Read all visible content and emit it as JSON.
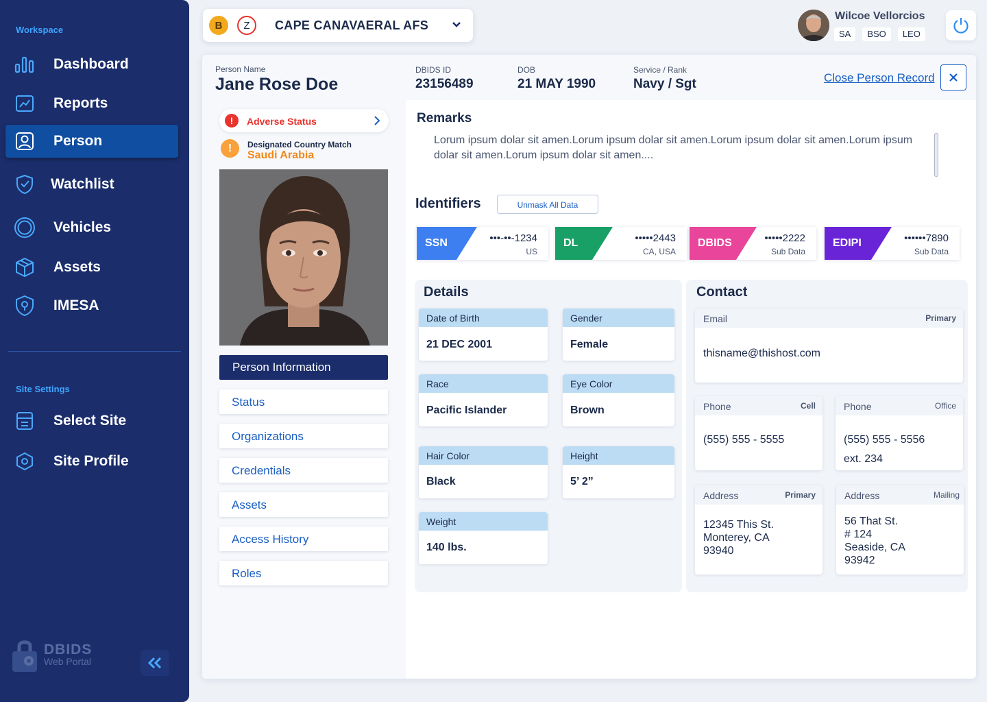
{
  "sidebar": {
    "workspace_label": "Workspace",
    "items": [
      {
        "label": "Dashboard"
      },
      {
        "label": "Reports"
      },
      {
        "label": "Person"
      },
      {
        "label": "Watchlist"
      },
      {
        "label": "Vehicles"
      },
      {
        "label": "Assets"
      },
      {
        "label": "IMESA"
      }
    ],
    "settings_label": "Site Settings",
    "settings_items": [
      {
        "label": "Select Site"
      },
      {
        "label": "Site Profile"
      }
    ],
    "logo_line1": "DBIDS",
    "logo_line2": "Web Portal",
    "active_item": "Person",
    "colors": {
      "background": "#1b2d6b",
      "active": "#0f4ea0",
      "section_label": "#3ea5ff"
    }
  },
  "topbar": {
    "badge_b": "B",
    "badge_z": "Z",
    "site_name": "CAPE CANAVAERAL AFS",
    "user_name": "Wilcoe Vellorcios",
    "roles": [
      "SA",
      "BSO",
      "LEO"
    ],
    "power_icon": "power-icon"
  },
  "person_header": {
    "name_label": "Person Name",
    "name": "Jane Rose Doe",
    "dbids_label": "DBIDS ID",
    "dbids_id": "23156489",
    "dob_label": "DOB",
    "dob": "21 MAY 1990",
    "service_label": "Service / Rank",
    "service": "Navy / Sgt",
    "close_link": "Close Person Record"
  },
  "status_panel": {
    "adverse_label": "Adverse Status",
    "country_match_label": "Designated Country Match",
    "country": "Saudi Arabia",
    "colors": {
      "adverse": "#e8332e",
      "country": "#f08a1c"
    }
  },
  "subnav": {
    "active": "Person Information",
    "items": [
      "Status",
      "Organizations",
      "Credentials",
      "Assets",
      "Access History",
      "Roles"
    ]
  },
  "remarks": {
    "title": "Remarks",
    "text": "Lorum ipsum dolar sit amen.Lorum ipsum dolar sit amen.Lorum ipsum dolar sit amen.Lorum ipsum dolar sit amen.Lorum ipsum dolar sit amen...."
  },
  "identifiers": {
    "title": "Identifiers",
    "unmask_label": "Unmask All Data",
    "cards": [
      {
        "type": "SSN",
        "value": "•••-••-1234",
        "sub": "US",
        "color": "#3d7ff0"
      },
      {
        "type": "DL",
        "value": "•••••2443",
        "sub": "CA, USA",
        "color": "#19a066"
      },
      {
        "type": "DBIDS",
        "value": "•••••2222",
        "sub": "Sub Data",
        "color": "#e8459b"
      },
      {
        "type": "EDIPI",
        "value": "••••••7890",
        "sub": "Sub Data",
        "color": "#6a24d8"
      }
    ]
  },
  "details": {
    "title": "Details",
    "fields": [
      {
        "label": "Date of Birth",
        "value": "21 DEC 2001"
      },
      {
        "label": "Gender",
        "value": "Female"
      },
      {
        "label": "Race",
        "value": "Pacific Islander"
      },
      {
        "label": "Eye Color",
        "value": "Brown"
      },
      {
        "label": "Hair Color",
        "value": "Black"
      },
      {
        "label": "Height",
        "value": "5’ 2”"
      },
      {
        "label": "Weight",
        "value": "140 lbs."
      }
    ]
  },
  "contact": {
    "title": "Contact",
    "email": {
      "label": "Email",
      "tag": "Primary",
      "value": "thisname@thishost.com"
    },
    "phone_cell": {
      "label": "Phone",
      "tag": "Cell",
      "value": "(555) 555 - 5555"
    },
    "phone_office": {
      "label": "Phone",
      "tag": "Office",
      "line1": "(555) 555 - 5556",
      "line2": "ext. 234"
    },
    "address_primary": {
      "label": "Address",
      "tag": "Primary",
      "line1": "12345 This St.",
      "line2": "Monterey, CA",
      "line3": "93940"
    },
    "address_mailing": {
      "label": "Address",
      "tag": "Mailing",
      "line1": "56 That St.",
      "line2": "# 124",
      "line3": "Seaside, CA",
      "line4": "93942"
    }
  }
}
